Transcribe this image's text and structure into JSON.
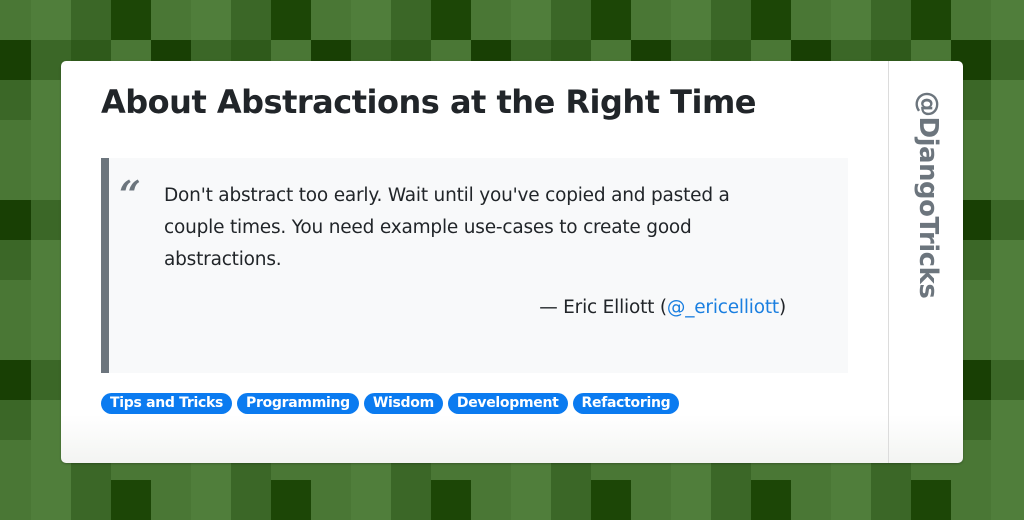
{
  "card": {
    "title": "About Abstractions at the Right Time",
    "quote": {
      "mark": "“",
      "text": "Don't abstract too early. Wait until you've copied and pasted a couple times. You need example use-cases to create good abstractions.",
      "attribution_prefix": "— Eric Elliott (",
      "author_handle": "@_ericelliott",
      "attribution_suffix": ")"
    },
    "tags": [
      "Tips and Tricks",
      "Programming",
      "Wisdom",
      "Development",
      "Refactoring"
    ],
    "side_handle": "@DjangoTricks"
  },
  "colors": {
    "tag_bg": "#0b7bf0",
    "link": "#1a7fe0",
    "quote_border": "#6c757d",
    "title": "#212529",
    "background_greens": [
      "#4a7735",
      "#507e3b",
      "#3b6727",
      "#1c4606",
      "#2f5a1b",
      "#183f04"
    ]
  }
}
